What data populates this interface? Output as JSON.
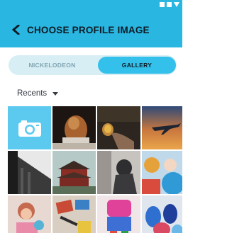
{
  "header": {
    "title": "CHOOSE PROFILE IMAGE",
    "back_icon": "chevron-left-icon"
  },
  "tabs": [
    {
      "label": "NICKELODEON",
      "selected": false
    },
    {
      "label": "GALLERY",
      "selected": true
    }
  ],
  "album": {
    "label": "Recents",
    "dropdown_icon": "caret-down-icon"
  },
  "gallery": {
    "camera_icon": "camera-icon",
    "photos": [
      "photo-dog-portrait",
      "photo-hand-dandelion",
      "photo-airplane-sunset",
      "photo-building-shadows",
      "photo-pagoda-temple",
      "photo-hooded-person",
      "photo-balloons-child",
      "photo-child-with-toy",
      "photo-craft-supplies",
      "photo-colorful-costume",
      "photo-painted-hands"
    ]
  },
  "colors": {
    "header_bg": "#29b6e0",
    "tab_selected_bg": "#33c0ea",
    "tab_track_bg": "#d7eef5",
    "camera_tile_bg": "#5cc9ef",
    "title_text": "#0f1a24"
  }
}
